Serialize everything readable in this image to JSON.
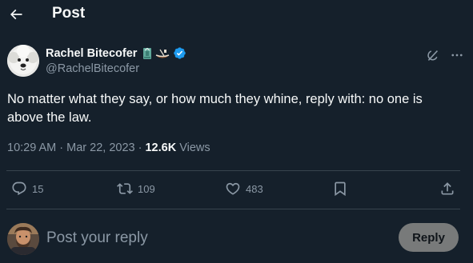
{
  "header": {
    "title": "Post"
  },
  "author": {
    "name": "Rachel Bitecofer",
    "handle": "@RachelBitecofer",
    "emojis": [
      "statue-of-liberty-emoji",
      "canoe-emoji"
    ],
    "verified": true
  },
  "tweet": {
    "text": "No matter what they say, or how much they whine, reply with: no one is above the law.",
    "timestamp": "10:29 AM · Mar 22, 2023 · ",
    "views_count": "12.6K",
    "views_label": " Views"
  },
  "actions": {
    "replies": "15",
    "reposts": "109",
    "likes": "483"
  },
  "reply": {
    "placeholder": "Post your reply",
    "button_label": "Reply"
  },
  "colors": {
    "background": "#15202b",
    "text": "#f7f9f9",
    "muted": "#8b98a5",
    "verified": "#1d9bf0",
    "divider": "#38444d"
  }
}
